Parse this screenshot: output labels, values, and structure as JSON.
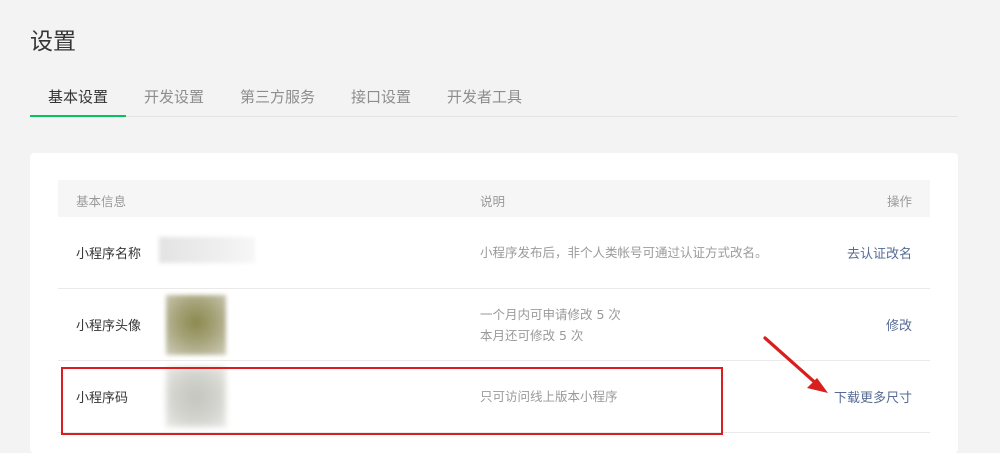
{
  "page": {
    "title": "设置"
  },
  "tabs": [
    {
      "label": "基本设置",
      "active": true
    },
    {
      "label": "开发设置",
      "active": false
    },
    {
      "label": "第三方服务",
      "active": false
    },
    {
      "label": "接口设置",
      "active": false
    },
    {
      "label": "开发者工具",
      "active": false
    }
  ],
  "table": {
    "headers": {
      "info": "基本信息",
      "desc": "说明",
      "action": "操作"
    },
    "rows": [
      {
        "label": "小程序名称",
        "desc_lines": [
          "小程序发布后，非个人类帐号可通过认证方式改名。"
        ],
        "action": "去认证改名"
      },
      {
        "label": "小程序头像",
        "desc_lines": [
          "一个月内可申请修改 5 次",
          "本月还可修改 5 次"
        ],
        "action": "修改"
      },
      {
        "label": "小程序码",
        "desc_lines": [
          "只可访问线上版本小程序"
        ],
        "action": "下载更多尺寸"
      }
    ]
  },
  "colors": {
    "accent": "#07c160",
    "link": "#576b95",
    "annotation": "#d81e1e"
  }
}
